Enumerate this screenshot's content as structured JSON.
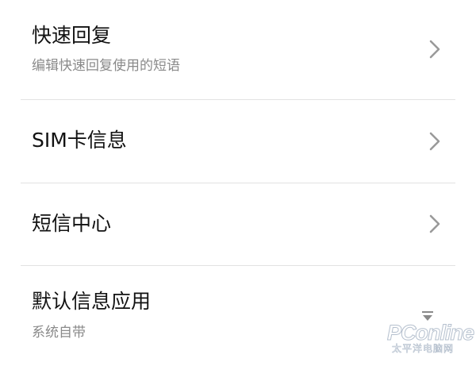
{
  "settings": {
    "items": [
      {
        "title": "快速回复",
        "subtitle": "编辑快速回复使用的短语",
        "icon": "chevron-right-icon"
      },
      {
        "title": "SIM卡信息",
        "icon": "chevron-right-icon"
      },
      {
        "title": "短信中心",
        "icon": "chevron-right-icon"
      },
      {
        "title": "默认信息应用",
        "subtitle": "系统自带",
        "icon": "dropdown-triangle-icon"
      }
    ]
  },
  "watermark": {
    "brand": "PConline",
    "tagline": "太平洋电脑网"
  },
  "colors": {
    "title": "#121212",
    "subtitle": "#8a8a8a",
    "divider": "#e2e2e2",
    "chevron": "#9a9a9a"
  }
}
